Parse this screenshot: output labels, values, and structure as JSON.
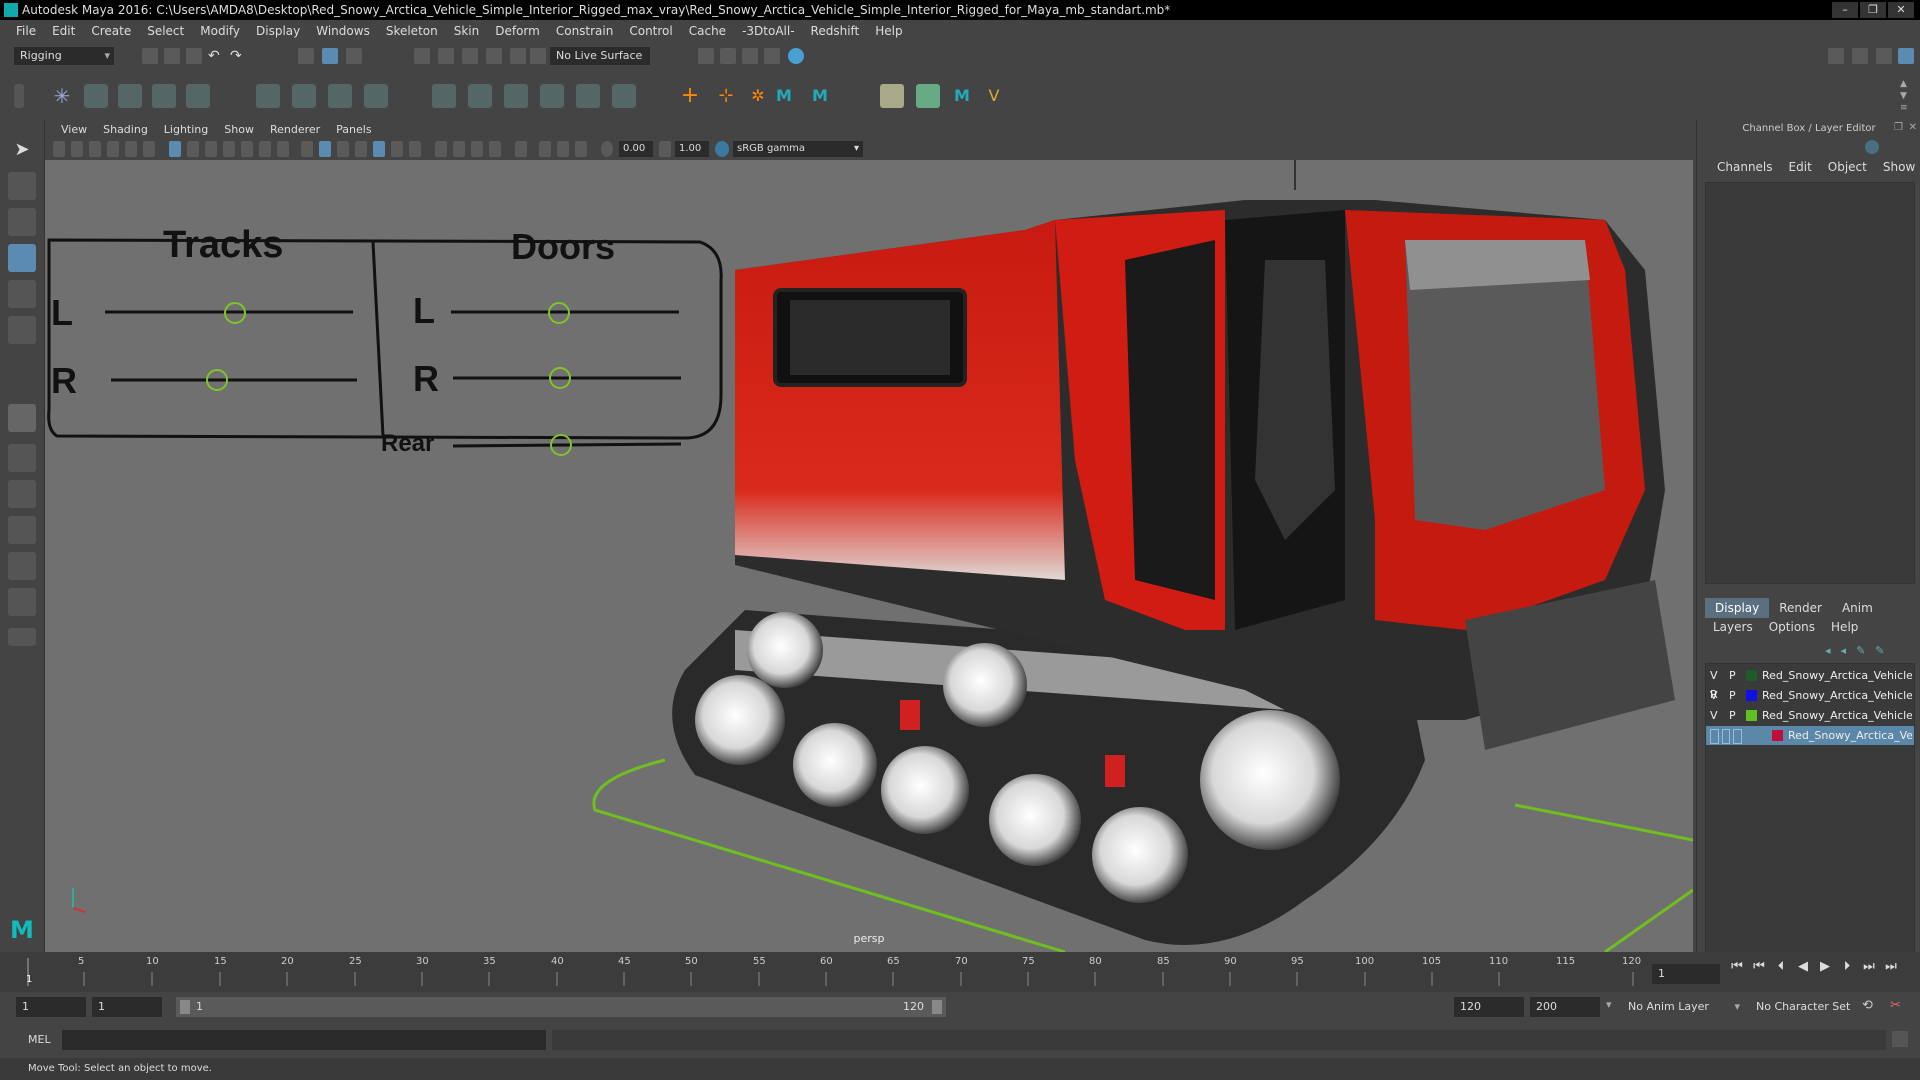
{
  "titlebar": {
    "title": "Autodesk Maya 2016: C:\\Users\\AMDA8\\Desktop\\Red_Snowy_Arctica_Vehicle_Simple_Interior_Rigged_max_vray\\Red_Snowy_Arctica_Vehicle_Simple_Interior_Rigged_for_Maya_mb_standart.mb*",
    "min": "–",
    "max": "❐",
    "close": "✕"
  },
  "menus": [
    "File",
    "Edit",
    "Create",
    "Select",
    "Modify",
    "Display",
    "Windows",
    "Skeleton",
    "Skin",
    "Deform",
    "Constrain",
    "Control",
    "Cache",
    "-3DtoAll-",
    "Redshift",
    "Help"
  ],
  "shelf": {
    "mode": "Rigging",
    "live_surface": "No Live Surface"
  },
  "panel": {
    "menus": [
      "View",
      "Shading",
      "Lighting",
      "Show",
      "Renderer",
      "Panels"
    ],
    "exposure": "0.00",
    "gamma": "1.00",
    "color_space": "sRGB gamma",
    "camera_label": "persp"
  },
  "rig_panel": {
    "tracks_title": "Tracks",
    "doors_title": "Doors",
    "tracks_l": "L",
    "tracks_r": "R",
    "doors_l": "L",
    "doors_r": "R",
    "doors_rear": "Rear"
  },
  "channel_box": {
    "title": "Channel Box / Layer Editor",
    "menus": [
      "Channels",
      "Edit",
      "Object",
      "Show"
    ],
    "tabs": [
      "Display",
      "Render",
      "Anim"
    ],
    "active_tab": "Display",
    "layer_menus": [
      "Layers",
      "Options",
      "Help"
    ],
    "layers": [
      {
        "vp": "V P R",
        "color": "#1f5a2a",
        "name": "Red_Snowy_Arctica_Vehicle_S"
      },
      {
        "vp": "V P",
        "color": "#1010e0",
        "name": "Red_Snowy_Arctica_Vehicle_S"
      },
      {
        "vp": "V P",
        "color": "#60c020",
        "name": "Red_Snowy_Arctica_Vehicle_S"
      },
      {
        "vp": "",
        "color": "#c0103a",
        "name": "Red_Snowy_Arctica_Veh"
      }
    ]
  },
  "timeline": {
    "ticks": [
      "5",
      "10",
      "15",
      "20",
      "25",
      "30",
      "35",
      "40",
      "45",
      "50",
      "55",
      "60",
      "65",
      "70",
      "75",
      "80",
      "85",
      "90",
      "95",
      "100",
      "105",
      "110",
      "115",
      "120"
    ],
    "current_frame": "1",
    "start_frame_label": "1"
  },
  "range": {
    "start": "1",
    "start_inner": "1",
    "range_start": "1",
    "range_end": "120",
    "end_inner": "120",
    "end": "200",
    "anim_layer": "No Anim Layer",
    "character_set": "No Character Set"
  },
  "cmd": {
    "label": "MEL"
  },
  "status": {
    "text": "Move Tool: Select an object to move."
  }
}
